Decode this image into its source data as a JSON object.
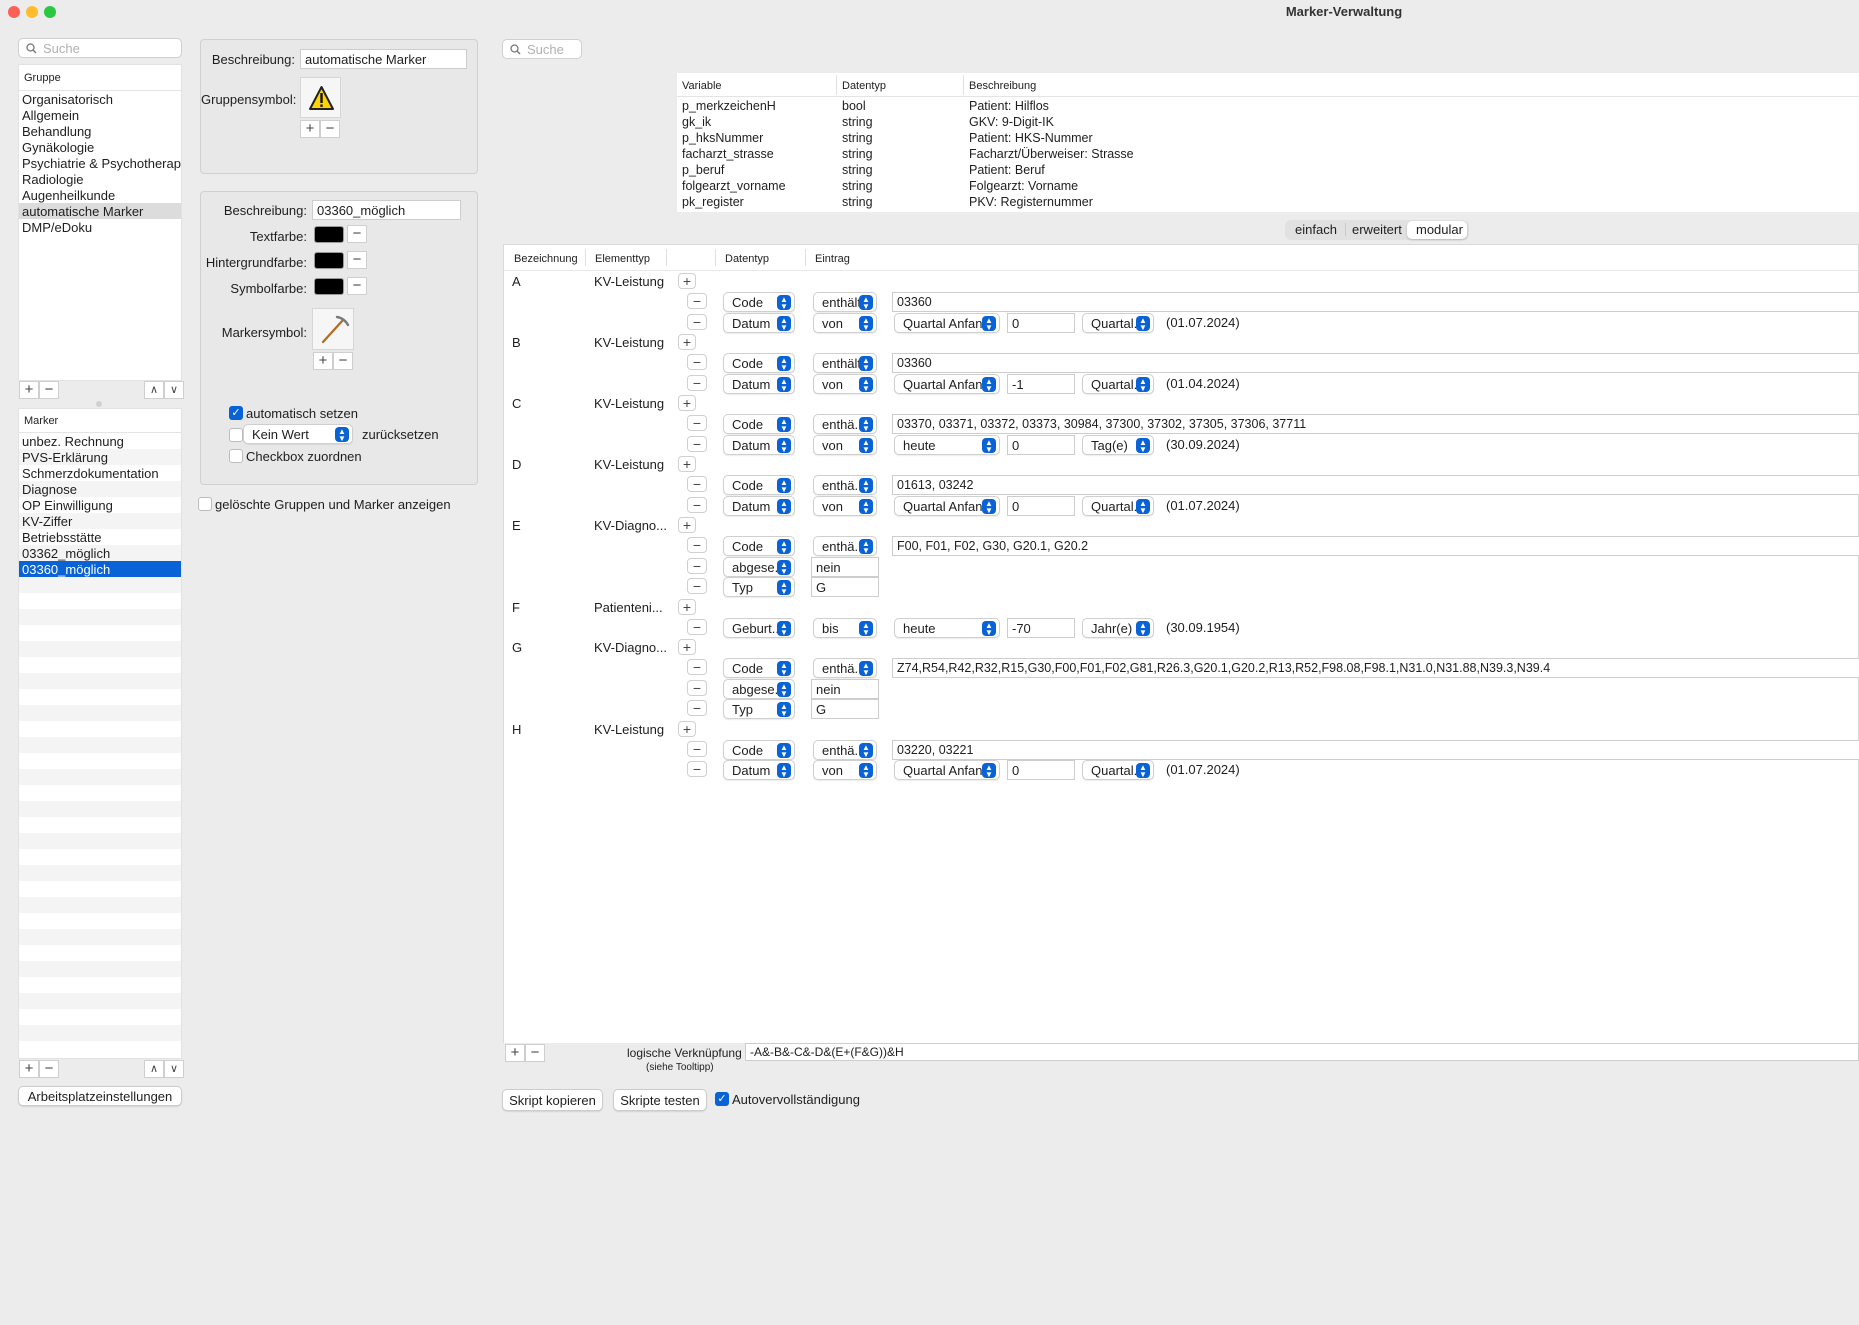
{
  "window": {
    "title": "Marker-Verwaltung"
  },
  "left": {
    "search_placeholder": "Suche",
    "group_header": "Gruppe",
    "groups": [
      "Organisatorisch",
      "Allgemein",
      "Behandlung",
      "Gynäkologie",
      "Psychiatrie & Psychotherapie",
      "Radiologie",
      "Augenheilkunde",
      "automatische Marker",
      "DMP/eDoku"
    ],
    "selected_group": 7,
    "marker_header": "Marker",
    "markers": [
      "unbez. Rechnung",
      "PVS-Erklärung",
      "Schmerzdokumentation",
      "Diagnose",
      "OP Einwilligung",
      "KV-Ziffer",
      "Betriebsstätte",
      "03362_möglich",
      "03360_möglich"
    ],
    "selected_marker": 8,
    "workplace_button": "Arbeitsplatzeinstellungen"
  },
  "group_panel": {
    "desc_label": "Beschreibung:",
    "desc_value": "automatische Marker",
    "symbol_label": "Gruppensymbol:"
  },
  "marker_panel": {
    "desc_label": "Beschreibung:",
    "desc_value": "03360_möglich",
    "text_color_label": "Textfarbe:",
    "bg_color_label": "Hintergrundfarbe:",
    "symbol_color_label": "Symbolfarbe:",
    "marker_symbol_label": "Markersymbol:",
    "auto_set_label": "automatisch setzen",
    "auto_set_checked": true,
    "no_value_option": "Kein Wert",
    "reset_label": "zurücksetzen",
    "checkbox_assign_label": "Checkbox zuordnen",
    "swatch_color": "#000000"
  },
  "show_deleted_label": "gelöschte Gruppen und Marker anzeigen",
  "right": {
    "search_placeholder": "Suche",
    "var_headers": [
      "Variable",
      "Datentyp",
      "Beschreibung"
    ],
    "variables": [
      [
        "p_merkzeichenH",
        "bool",
        "Patient: Hilflos"
      ],
      [
        "gk_ik",
        "string",
        "GKV: 9-Digit-IK"
      ],
      [
        "p_hksNummer",
        "string",
        "Patient: HKS-Nummer"
      ],
      [
        "facharzt_strasse",
        "string",
        "Facharzt/Überweiser: Strasse"
      ],
      [
        "p_beruf",
        "string",
        "Patient: Beruf"
      ],
      [
        "folgearzt_vorname",
        "string",
        "Folgearzt: Vorname"
      ],
      [
        "pk_register",
        "string",
        "PKV: Registernummer"
      ]
    ],
    "modes": [
      "einfach",
      "erweitert",
      "modular"
    ],
    "active_mode": 2,
    "rule_headers": [
      "Bezeichnung",
      "Elementtyp",
      "Datentyp",
      "Eintrag"
    ],
    "rules": [
      {
        "id": "A",
        "type": "KV-Leistung",
        "lines": [
          {
            "kind": "code",
            "dt": "Code",
            "op": "enthält",
            "val": "03360"
          },
          {
            "kind": "date",
            "dt": "Datum",
            "op": "von",
            "ref": "Quartal Anfang",
            "num": "0",
            "unit": "Quartal...",
            "result": "(01.07.2024)"
          }
        ]
      },
      {
        "id": "B",
        "type": "KV-Leistung",
        "lines": [
          {
            "kind": "code",
            "dt": "Code",
            "op": "enthält",
            "val": "03360"
          },
          {
            "kind": "date",
            "dt": "Datum",
            "op": "von",
            "ref": "Quartal Anfang",
            "num": "-1",
            "unit": "Quartal...",
            "result": "(01.04.2024)"
          }
        ]
      },
      {
        "id": "C",
        "type": "KV-Leistung",
        "lines": [
          {
            "kind": "code",
            "dt": "Code",
            "op": "enthä...",
            "val": "03370, 03371, 03372, 03373, 30984, 37300, 37302, 37305, 37306, 37711"
          },
          {
            "kind": "date",
            "dt": "Datum",
            "op": "von",
            "ref": "heute",
            "num": "0",
            "unit": "Tag(e)",
            "result": "(30.09.2024)"
          }
        ]
      },
      {
        "id": "D",
        "type": "KV-Leistung",
        "lines": [
          {
            "kind": "code",
            "dt": "Code",
            "op": "enthä...",
            "val": "01613, 03242"
          },
          {
            "kind": "date",
            "dt": "Datum",
            "op": "von",
            "ref": "Quartal Anfang",
            "num": "0",
            "unit": "Quartal...",
            "result": "(01.07.2024)"
          }
        ]
      },
      {
        "id": "E",
        "type": "KV-Diagno...",
        "lines": [
          {
            "kind": "code",
            "dt": "Code",
            "op": "enthä...",
            "val": "F00, F01, F02, G30, G20.1, G20.2"
          },
          {
            "kind": "short",
            "dt": "abgese...",
            "val": "nein"
          },
          {
            "kind": "short",
            "dt": "Typ",
            "val": "G"
          }
        ]
      },
      {
        "id": "F",
        "type": "Patienteni...",
        "lines": [
          {
            "kind": "date",
            "dt": "Geburt...",
            "op": "bis",
            "ref": "heute",
            "num": "-70",
            "unit": "Jahr(e)",
            "result": "(30.09.1954)"
          }
        ]
      },
      {
        "id": "G",
        "type": "KV-Diagno...",
        "lines": [
          {
            "kind": "code",
            "dt": "Code",
            "op": "enthä...",
            "val": "Z74,R54,R42,R32,R15,G30,F00,F01,F02,G81,R26.3,G20.1,G20.2,R13,R52,F98.08,F98.1,N31.0,N31.88,N39.3,N39.4"
          },
          {
            "kind": "short",
            "dt": "abgese...",
            "val": "nein"
          },
          {
            "kind": "short",
            "dt": "Typ",
            "val": "G"
          }
        ]
      },
      {
        "id": "H",
        "type": "KV-Leistung",
        "lines": [
          {
            "kind": "code",
            "dt": "Code",
            "op": "enthä...",
            "val": "03220, 03221"
          },
          {
            "kind": "date",
            "dt": "Datum",
            "op": "von",
            "ref": "Quartal Anfang",
            "num": "0",
            "unit": "Quartal...",
            "result": "(01.07.2024)"
          }
        ]
      }
    ],
    "logic_label": "logische Verknüpfung",
    "logic_hint": "(siehe Tooltipp)",
    "logic_value": "-A&-B&-C&-D&(E+(F&G))&H",
    "copy_button": "Skript kopieren",
    "test_button": "Skripte testen",
    "autocomplete_label": "Autovervollständigung",
    "autocomplete_checked": true
  }
}
